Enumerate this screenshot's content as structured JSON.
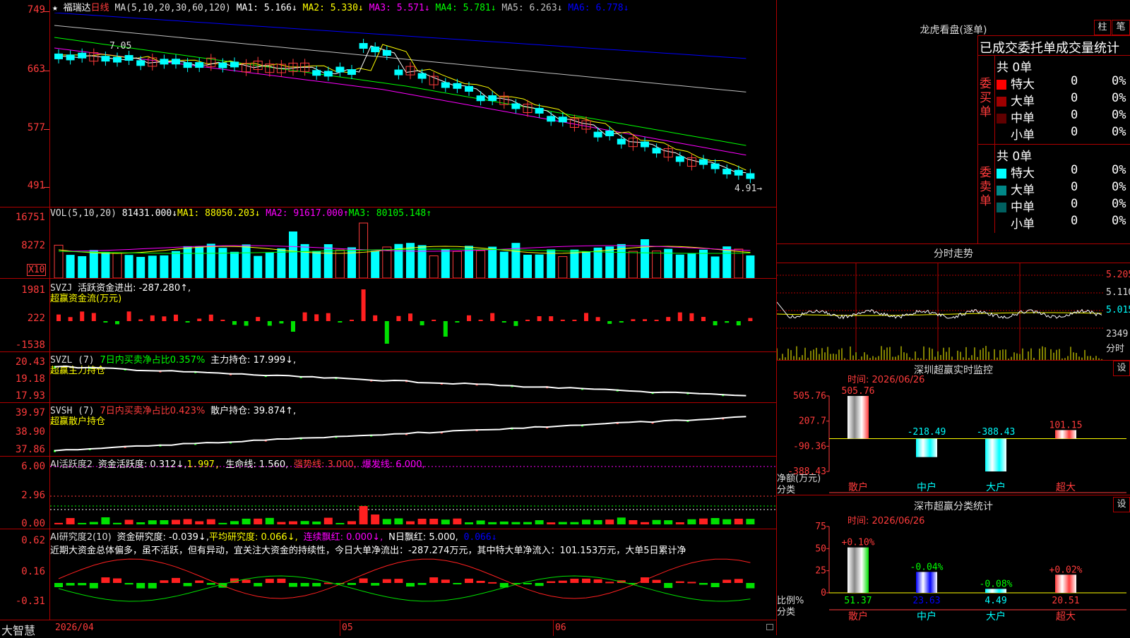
{
  "header": {
    "star": "★",
    "stock_name": "福瑞达",
    "period": "日线",
    "ma_label": "MA(5,10,20,30,60,120)",
    "ma": [
      {
        "text": "MA1: 5.166↓",
        "color": "#ffffff"
      },
      {
        "text": "MA2: 5.330↓",
        "color": "#ffff00"
      },
      {
        "text": "MA3: 5.571↓",
        "color": "#ff00ff"
      },
      {
        "text": "MA4: 5.781↓",
        "color": "#00ff00"
      },
      {
        "text": "MA5: 6.263↓",
        "color": "#c0c0c0"
      },
      {
        "text": "MA6: 6.778↓",
        "color": "#0000ff"
      }
    ],
    "top_axis_mark": "749"
  },
  "main_chart": {
    "axis": [
      "749",
      "663",
      "577",
      "491"
    ],
    "annotation_high": "7.05",
    "annotation_last": "4.91→"
  },
  "vol_panel": {
    "title": "VOL(5,10,20)",
    "value": "81431.000↓",
    "ma1": "MA1: 88050.203↓",
    "ma2": "MA2: 91617.000↑",
    "ma3": "MA3: 80105.148↑",
    "axis": [
      "16751",
      "8272"
    ],
    "unit": "X10"
  },
  "svzj_panel": {
    "title": "SVZJ",
    "value": "活跃资金进出: -287.280↑,",
    "subtitle": "超赢资金流(万元)",
    "axis": [
      "1981",
      "222",
      "-1538"
    ]
  },
  "svzl_panel": {
    "title": "SVZL (7)",
    "ratio": "7日内买卖净占比0.357%",
    "hold": "主力持仓: 17.999↓,",
    "subtitle": "超赢主力持仓",
    "axis": [
      "20.43",
      "19.18",
      "17.93"
    ]
  },
  "svsh_panel": {
    "title": "SVSH (7)",
    "ratio": "7日内买卖净占比0.423%",
    "hold": "散户持仓: 39.874↑,",
    "subtitle": "超赢散户持仓",
    "axis": [
      "39.97",
      "38.90",
      "37.86"
    ]
  },
  "ai_active_panel": {
    "title": "AI活跃度2",
    "active": "资金活跃度: 0.312↓,",
    "v2": "1.997,",
    "life": "生命线: 1.560,",
    "strong": "强势线: 3.000,",
    "burst": "爆发线: 6.000,",
    "axis": [
      "6.00",
      "2.96",
      "0.00"
    ]
  },
  "ai_research_panel": {
    "title": "AI研究度2(10)",
    "research": "资金研究度: -0.039↓,",
    "avg": "平均研究度: 0.066↓,",
    "red": "连续飘红: 0.000↓,",
    "nred": "N日飘红: 5.000,",
    "last": "0.066↓",
    "comment": "近期大资金总体偏多，虽不活跃，但有异动，宜关注大资金的持续性，今日大单净流出：-287.274万元，其中特大单净流入：101.153万元，大单5日累计净",
    "axis": [
      "0.62",
      "0.16",
      "-0.31"
    ]
  },
  "bottom_bar": {
    "brand": "大智慧",
    "date": "2026/04",
    "month1": "05",
    "month2": "06"
  },
  "lhb": {
    "title": "龙虎看盘(逐单)",
    "btn1": "柱",
    "btn2": "笔",
    "tabs": "已成交委托单成交量统计",
    "buy_label": "委买单",
    "sell_label": "委卖单",
    "buy_total": "共 0单",
    "sell_total": "共 0单",
    "buy_rows": [
      {
        "name": "特大",
        "count": "0",
        "pct": "0%",
        "color": "#ff0000"
      },
      {
        "name": "大单",
        "count": "0",
        "pct": "0%",
        "color": "#a00000"
      },
      {
        "name": "中单",
        "count": "0",
        "pct": "0%",
        "color": "#600000"
      },
      {
        "name": "小单",
        "count": "0",
        "pct": "0%",
        "color": "#000000"
      }
    ],
    "sell_rows": [
      {
        "name": "特大",
        "count": "0",
        "pct": "0%",
        "color": "#00ffff"
      },
      {
        "name": "大单",
        "count": "0",
        "pct": "0%",
        "color": "#008888"
      },
      {
        "name": "中单",
        "count": "0",
        "pct": "0%",
        "color": "#006060"
      },
      {
        "name": "小单",
        "count": "0",
        "pct": "0%",
        "color": "#000000"
      }
    ]
  },
  "intraday": {
    "title": "分时走势",
    "axis": [
      "5.205",
      "5.110",
      "5.015",
      "2349",
      "分时"
    ]
  },
  "sz_monitor": {
    "title": "深圳超赢实时监控",
    "btn": "设",
    "time": "时间: 2026/06/26",
    "axis": [
      "505.76",
      "207.7",
      "-90.36",
      "-388.43"
    ],
    "ylabel": "净额(万元)",
    "xlabel": "分类",
    "categories": [
      "散户",
      "中户",
      "大户",
      "超大"
    ],
    "value_labels": [
      "505.76",
      "-218.49",
      "-388.43",
      "101.15"
    ]
  },
  "sz_class": {
    "title": "深市超赢分类统计",
    "btn": "设",
    "time": "时间: 2026/06/26",
    "axis": [
      "75",
      "50",
      "25",
      "0"
    ],
    "ylabel": "比例%",
    "xlabel": "分类",
    "categories": [
      "散户",
      "中户",
      "大户",
      "超大"
    ],
    "change_labels": [
      "+0.10%",
      "-0.04%",
      "-0.08%",
      "+0.02%"
    ],
    "value_labels": [
      "51.37",
      "23.63",
      "4.49",
      "20.51"
    ]
  },
  "chart_data": [
    {
      "type": "bar",
      "title": "深圳超赢实时监控",
      "ylabel": "净额(万元)",
      "categories": [
        "散户",
        "中户",
        "大户",
        "超大"
      ],
      "values": [
        505.76,
        -218.49,
        -388.43,
        101.15
      ],
      "ylim": [
        -388.43,
        505.76
      ]
    },
    {
      "type": "bar",
      "title": "深市超赢分类统计",
      "ylabel": "比例%",
      "categories": [
        "散户",
        "中户",
        "大户",
        "超大"
      ],
      "values": [
        51.37,
        23.63,
        4.49,
        20.51
      ],
      "ylim": [
        0,
        75
      ]
    }
  ]
}
